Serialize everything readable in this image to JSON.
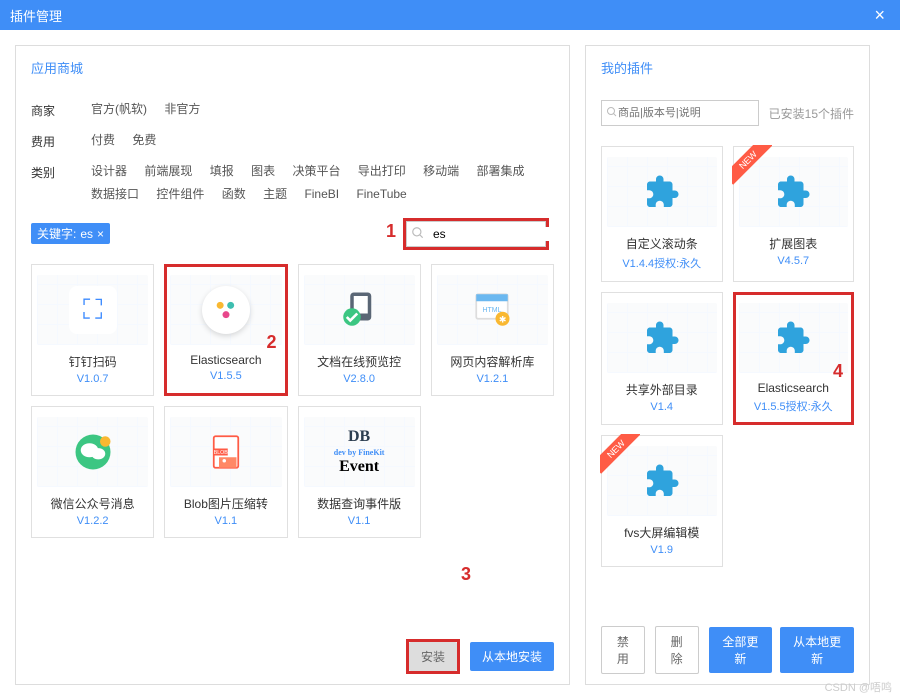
{
  "titleBar": {
    "title": "插件管理",
    "close": "×"
  },
  "leftPanel": {
    "title": "应用商城",
    "filters": {
      "vendor": {
        "label": "商家",
        "options": [
          "官方(帆软)",
          "非官方"
        ]
      },
      "cost": {
        "label": "费用",
        "options": [
          "付费",
          "免费"
        ]
      },
      "category": {
        "label": "类别",
        "options": [
          "设计器",
          "前端展现",
          "填报",
          "图表",
          "决策平台",
          "导出打印",
          "移动端",
          "部署集成",
          "数据接口",
          "控件组件",
          "函数",
          "主题",
          "FineBI",
          "FineTube"
        ]
      }
    },
    "keywordPrefix": "关键字:",
    "keywordValue": "es",
    "keywordClose": "×",
    "searchValue": "es",
    "badge1": "1",
    "badge2": "2",
    "badge3": "3",
    "cards": [
      {
        "name": "钉钉扫码",
        "version": "V1.0.7",
        "icon": "scan"
      },
      {
        "name": "Elasticsearch",
        "version": "V1.5.5",
        "icon": "elastic",
        "highlight": true
      },
      {
        "name": "文档在线预览控",
        "version": "V2.8.0",
        "icon": "doc"
      },
      {
        "name": "网页内容解析库",
        "version": "V1.2.1",
        "icon": "html"
      },
      {
        "name": "微信公众号消息",
        "version": "V1.2.2",
        "icon": "wechat"
      },
      {
        "name": "Blob图片压缩转",
        "version": "V1.1",
        "icon": "blob"
      },
      {
        "name": "数据查询事件版",
        "version": "V1.1",
        "icon": "dbevent"
      }
    ],
    "installBtn": "安装",
    "localInstallBtn": "从本地安装"
  },
  "rightPanel": {
    "title": "我的插件",
    "searchPlaceholder": "商品|版本号|说明",
    "installedCount": "已安装15个插件",
    "badge4": "4",
    "cards": [
      {
        "name": "自定义滚动条",
        "version": "V1.4.4授权:永久"
      },
      {
        "name": "扩展图表",
        "version": "V4.5.7",
        "isNew": true
      },
      {
        "name": "共享外部目录",
        "version": "V1.4"
      },
      {
        "name": "Elasticsearch",
        "version": "V1.5.5授权:永久",
        "highlight": true
      },
      {
        "name": "fvs大屏编辑模",
        "version": "V1.9",
        "isNew": true
      }
    ],
    "disableBtn": "禁用",
    "deleteBtn": "删除",
    "updateAllBtn": "全部更新",
    "localUpdateBtn": "从本地更新"
  },
  "watermark": "CSDN @唔鸣",
  "ribbonText": "NEW"
}
